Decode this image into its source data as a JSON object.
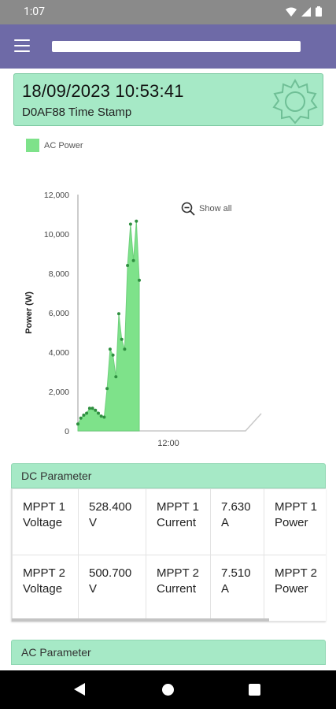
{
  "status_bar": {
    "time": "1:07"
  },
  "stamp": {
    "datetime": "18/09/2023 10:53:41",
    "label": "D0AF88 Time Stamp"
  },
  "chart_controls": {
    "show_all": "Show all"
  },
  "colors": {
    "accent_green": "#a6e9c6",
    "app_bar": "#6e6aa7",
    "series_fill": "#7ee28a"
  },
  "chart_data": {
    "type": "area",
    "ylabel": "Power (W)",
    "ylim": [
      0,
      12000
    ],
    "yticks": [
      "0",
      "2,000",
      "4,000",
      "6,000",
      "8,000",
      "10,000",
      "12,000"
    ],
    "xticks": [
      "12:00"
    ],
    "grid": false,
    "legend": "top-left",
    "series": [
      {
        "name": "AC Power",
        "color": "#7ee28a",
        "values": [
          350,
          650,
          800,
          900,
          1150,
          1150,
          1050,
          900,
          750,
          700,
          2150,
          4150,
          3850,
          2750,
          5950,
          4650,
          4150,
          8400,
          10500,
          8650,
          10650,
          7650
        ]
      }
    ]
  },
  "dc_parameter": {
    "title": "DC Parameter",
    "rows": [
      [
        "MPPT 1 Voltage",
        "528.400 V",
        "MPPT 1 Current",
        "7.630 A",
        "MPPT 1 Power"
      ],
      [
        "MPPT 2 Voltage",
        "500.700 V",
        "MPPT 2 Current",
        "7.510 A",
        "MPPT 2 Power"
      ]
    ]
  },
  "ac_parameter": {
    "title": "AC Parameter"
  }
}
